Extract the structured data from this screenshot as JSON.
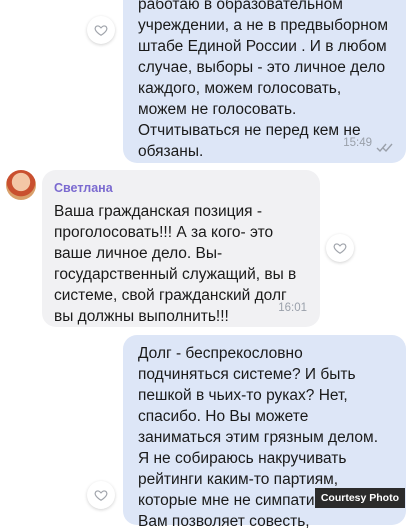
{
  "messages": [
    {
      "direction": "outgoing",
      "lines": [
        "работаю в образовательном",
        "учреждении, а не в предвыборном",
        "штабе Единой России . И в любом",
        "случае, выборы - это личное дело",
        "каждого, можем голосовать,",
        "можем не голосовать.",
        "Отчитываться не перед кем не",
        "обязаны."
      ],
      "time": "15:49"
    },
    {
      "direction": "incoming",
      "sender": "Светлана",
      "lines": [
        "Ваша гражданская позиция -",
        "проголосовать!!! А за кого- это",
        "ваше личное дело. Вы-",
        "государственный служащий, вы в",
        "системе, свой гражданский долг",
        "вы должны выполнить!!!"
      ],
      "time": "16:01"
    },
    {
      "direction": "outgoing",
      "lines": [
        "Долг - беспрекословно",
        "подчиняться системе? И быть",
        "пешкой в чьих-то руках? Нет,",
        "спасибо. Но Вы можете",
        "заниматься этим грязным делом.",
        "Я не собираюсь накручивать",
        "рейтинги каким-то партиям,",
        "которые мне не симпатичны. Если",
        "Вам позволяет совесть,"
      ]
    }
  ],
  "credit": "Courtesy Photo",
  "colors": {
    "outgoing_bubble": "#dde6f7",
    "incoming_bubble": "#f1f1f3",
    "sender_name": "#7b6ad0",
    "timestamp": "#9aa0aa"
  },
  "icons": {
    "like": "heart-outline-icon",
    "read_status": "double-check-icon"
  }
}
